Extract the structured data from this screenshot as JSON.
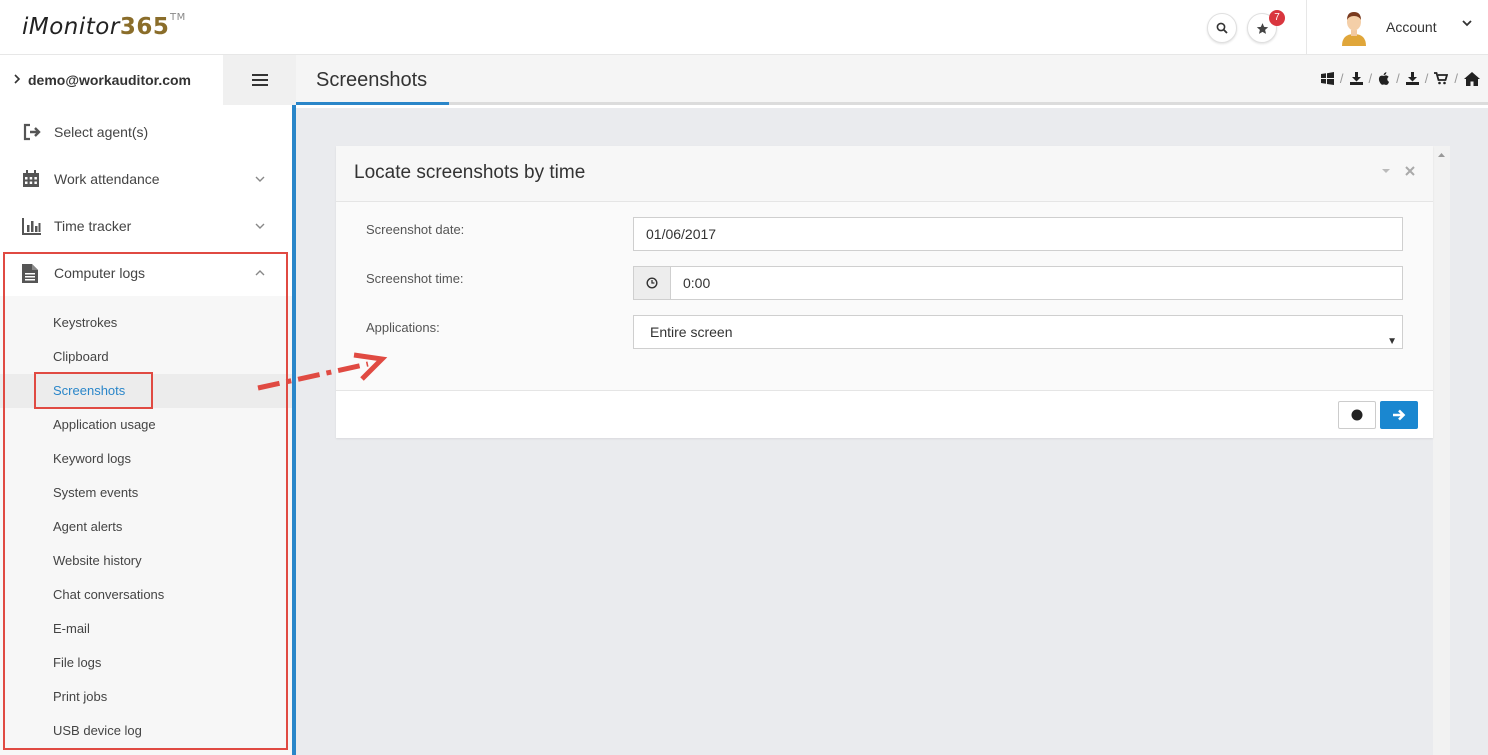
{
  "brand": {
    "name_prefix": "iMonitor",
    "name_suffix": "365",
    "trademark": "TM"
  },
  "topbar": {
    "notifications_count": "7",
    "account_label": "Account"
  },
  "user": {
    "email": "demo@workauditor.com"
  },
  "page": {
    "title": "Screenshots"
  },
  "breadcrumbs": {
    "icons": [
      "windows-icon",
      "download-icon",
      "apple-icon",
      "download-icon",
      "cart-icon",
      "home-icon"
    ],
    "separator": "/"
  },
  "sidebar": {
    "items": [
      {
        "label": "Select agent(s)",
        "icon": "sign-out-icon"
      },
      {
        "label": "Work attendance",
        "icon": "calendar-icon"
      },
      {
        "label": "Time tracker",
        "icon": "bar-chart-icon"
      },
      {
        "label": "Computer logs",
        "icon": "document-icon"
      }
    ],
    "sub_items": [
      "Keystrokes",
      "Clipboard",
      "Screenshots",
      "Application usage",
      "Keyword logs",
      "System events",
      "Agent alerts",
      "Website history",
      "Chat conversations",
      "E-mail",
      "File logs",
      "Print jobs",
      "USB device log"
    ],
    "active_sub_item": "Screenshots"
  },
  "panel": {
    "title": "Locate screenshots by time",
    "fields": {
      "date_label": "Screenshot date:",
      "date_value": "01/06/2017",
      "time_label": "Screenshot time:",
      "time_value": "0:00",
      "apps_label": "Applications:",
      "apps_value": "Entire screen"
    }
  },
  "colors": {
    "accent": "#2a86c9",
    "annotation_red": "#e04a42",
    "button_blue": "#1a87d0",
    "badge_red": "#d9363e"
  }
}
